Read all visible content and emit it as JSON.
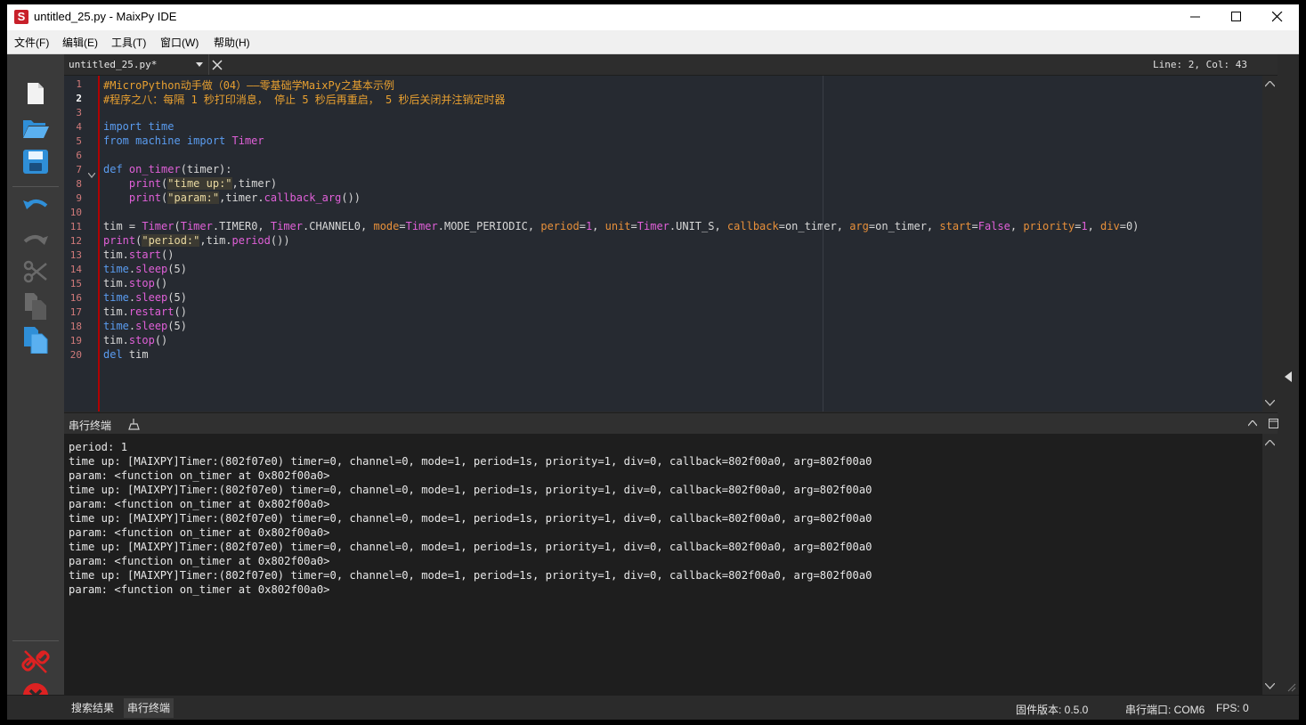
{
  "window": {
    "title": "untitled_25.py - MaixPy IDE",
    "app_icon_letter": "S"
  },
  "menu": [
    "文件(F)",
    "编辑(E)",
    "工具(T)",
    "窗口(W)",
    "帮助(H)"
  ],
  "editor": {
    "tab_label": "untitled_25.py*",
    "cursor_position": "Line: 2, Col: 43",
    "current_line": 2,
    "line_numbers": [
      "1",
      "2",
      "3",
      "4",
      "5",
      "6",
      "7",
      "8",
      "9",
      "10",
      "11",
      "12",
      "13",
      "14",
      "15",
      "16",
      "17",
      "18",
      "19",
      "20"
    ],
    "code_lines": [
      [
        {
          "t": "#MicroPython动手做（04）——零基础学MaixPy之基本示例",
          "c": "com"
        }
      ],
      [
        {
          "t": "#程序之八：每隔 1 秒打印消息， 停止 5 秒后再重启， 5 秒后关闭并注销定时器",
          "c": "com"
        }
      ],
      [],
      [
        {
          "t": "import ",
          "c": "kw"
        },
        {
          "t": "time",
          "c": "mod"
        }
      ],
      [
        {
          "t": "from ",
          "c": "kw"
        },
        {
          "t": "machine ",
          "c": "mod"
        },
        {
          "t": "import ",
          "c": "kw"
        },
        {
          "t": "Timer",
          "c": "cls"
        }
      ],
      [],
      [
        {
          "t": "def ",
          "c": "kw"
        },
        {
          "t": "on_timer",
          "c": "fn"
        },
        {
          "t": "(timer):",
          "c": "plain"
        }
      ],
      [
        {
          "t": "    print",
          "c": "fn"
        },
        {
          "t": "(",
          "c": "plain"
        },
        {
          "t": "\"time up:\"",
          "c": "str"
        },
        {
          "t": ",timer)",
          "c": "plain"
        }
      ],
      [
        {
          "t": "    print",
          "c": "fn"
        },
        {
          "t": "(",
          "c": "plain"
        },
        {
          "t": "\"param:\"",
          "c": "str"
        },
        {
          "t": ",timer.",
          "c": "plain"
        },
        {
          "t": "callback_arg",
          "c": "fn"
        },
        {
          "t": "())",
          "c": "plain"
        }
      ],
      [],
      [
        {
          "t": "tim = ",
          "c": "plain"
        },
        {
          "t": "Timer",
          "c": "cls"
        },
        {
          "t": "(",
          "c": "plain"
        },
        {
          "t": "Timer",
          "c": "cls"
        },
        {
          "t": ".TIMER0, ",
          "c": "plain"
        },
        {
          "t": "Timer",
          "c": "cls"
        },
        {
          "t": ".CHANNEL0, ",
          "c": "plain"
        },
        {
          "t": "mode",
          "c": "kwarg"
        },
        {
          "t": "=",
          "c": "plain"
        },
        {
          "t": "Timer",
          "c": "cls"
        },
        {
          "t": ".MODE_PERIODIC, ",
          "c": "plain"
        },
        {
          "t": "period",
          "c": "kwarg"
        },
        {
          "t": "=",
          "c": "plain"
        },
        {
          "t": "1",
          "c": "num"
        },
        {
          "t": ", ",
          "c": "plain"
        },
        {
          "t": "unit",
          "c": "kwarg"
        },
        {
          "t": "=",
          "c": "plain"
        },
        {
          "t": "Timer",
          "c": "cls"
        },
        {
          "t": ".UNIT_S, ",
          "c": "plain"
        },
        {
          "t": "callback",
          "c": "kwarg"
        },
        {
          "t": "=on_timer, ",
          "c": "plain"
        },
        {
          "t": "arg",
          "c": "kwarg"
        },
        {
          "t": "=on_timer, ",
          "c": "plain"
        },
        {
          "t": "start",
          "c": "kwarg"
        },
        {
          "t": "=",
          "c": "plain"
        },
        {
          "t": "False",
          "c": "cls"
        },
        {
          "t": ", ",
          "c": "plain"
        },
        {
          "t": "priority",
          "c": "kwarg"
        },
        {
          "t": "=",
          "c": "plain"
        },
        {
          "t": "1",
          "c": "num"
        },
        {
          "t": ", ",
          "c": "plain"
        },
        {
          "t": "div",
          "c": "kwarg"
        },
        {
          "t": "=0)",
          "c": "plain"
        }
      ],
      [
        {
          "t": "print",
          "c": "fn"
        },
        {
          "t": "(",
          "c": "plain"
        },
        {
          "t": "\"period:\"",
          "c": "str"
        },
        {
          "t": ",tim.",
          "c": "plain"
        },
        {
          "t": "period",
          "c": "fn"
        },
        {
          "t": "())",
          "c": "plain"
        }
      ],
      [
        {
          "t": "tim.",
          "c": "plain"
        },
        {
          "t": "start",
          "c": "fn"
        },
        {
          "t": "()",
          "c": "plain"
        }
      ],
      [
        {
          "t": "time",
          "c": "mod"
        },
        {
          "t": ".",
          "c": "plain"
        },
        {
          "t": "sleep",
          "c": "fn"
        },
        {
          "t": "(5)",
          "c": "plain"
        }
      ],
      [
        {
          "t": "tim.",
          "c": "plain"
        },
        {
          "t": "stop",
          "c": "fn"
        },
        {
          "t": "()",
          "c": "plain"
        }
      ],
      [
        {
          "t": "time",
          "c": "mod"
        },
        {
          "t": ".",
          "c": "plain"
        },
        {
          "t": "sleep",
          "c": "fn"
        },
        {
          "t": "(5)",
          "c": "plain"
        }
      ],
      [
        {
          "t": "tim.",
          "c": "plain"
        },
        {
          "t": "restart",
          "c": "fn"
        },
        {
          "t": "()",
          "c": "plain"
        }
      ],
      [
        {
          "t": "time",
          "c": "mod"
        },
        {
          "t": ".",
          "c": "plain"
        },
        {
          "t": "sleep",
          "c": "fn"
        },
        {
          "t": "(5)",
          "c": "plain"
        }
      ],
      [
        {
          "t": "tim.",
          "c": "plain"
        },
        {
          "t": "stop",
          "c": "fn"
        },
        {
          "t": "()",
          "c": "plain"
        }
      ],
      [
        {
          "t": "del ",
          "c": "kw"
        },
        {
          "t": "tim",
          "c": "plain"
        }
      ]
    ]
  },
  "terminal": {
    "title": "串行终端",
    "lines": [
      "period: 1",
      "time up: [MAIXPY]Timer:(802f07e0) timer=0, channel=0, mode=1, period=1s, priority=1, div=0, callback=802f00a0, arg=802f00a0",
      "param: <function on_timer at 0x802f00a0>",
      "time up: [MAIXPY]Timer:(802f07e0) timer=0, channel=0, mode=1, period=1s, priority=1, div=0, callback=802f00a0, arg=802f00a0",
      "param: <function on_timer at 0x802f00a0>",
      "time up: [MAIXPY]Timer:(802f07e0) timer=0, channel=0, mode=1, period=1s, priority=1, div=0, callback=802f00a0, arg=802f00a0",
      "param: <function on_timer at 0x802f00a0>",
      "time up: [MAIXPY]Timer:(802f07e0) timer=0, channel=0, mode=1, period=1s, priority=1, div=0, callback=802f00a0, arg=802f00a0",
      "param: <function on_timer at 0x802f00a0>",
      "time up: [MAIXPY]Timer:(802f07e0) timer=0, channel=0, mode=1, period=1s, priority=1, div=0, callback=802f00a0, arg=802f00a0",
      "param: <function on_timer at 0x802f00a0>"
    ]
  },
  "statusbar": {
    "tab_search": "搜索结果",
    "tab_serial": "串行终端",
    "firmware": "固件版本: 0.5.0",
    "port": "串行端口: COM6",
    "fps": "FPS: 0"
  },
  "colors": {
    "com": "#e8a030",
    "kw": "#5a9cf0",
    "mod": "#5a9cf0",
    "cls": "#e060d8",
    "fn": "#e060d8",
    "str": "#e8d8a0",
    "kwarg": "#e8903a",
    "num": "#e060d8",
    "plain": "#d8d8d8"
  }
}
